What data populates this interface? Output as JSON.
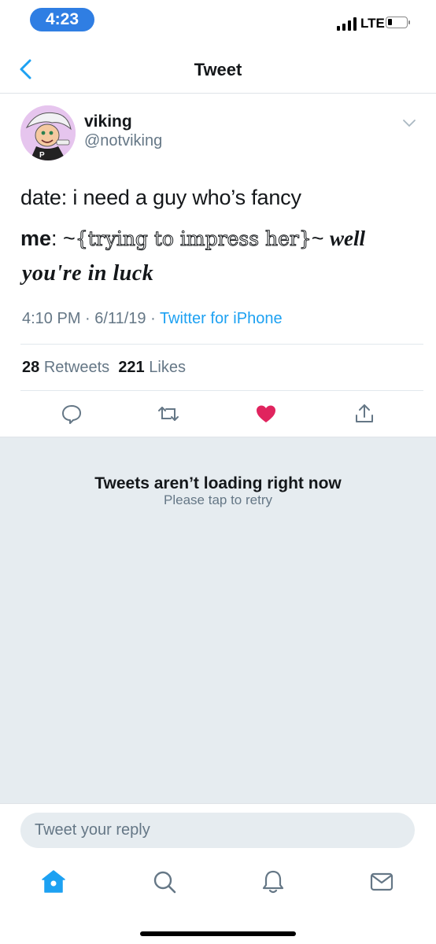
{
  "status_bar": {
    "time": "4:23",
    "network": "LTE"
  },
  "nav": {
    "title": "Tweet"
  },
  "tweet": {
    "display_name": "viking",
    "handle": "@notviking",
    "line1": "date: i need a guy who’s fancy",
    "line2_me": "me",
    "line2_colon": ": ~",
    "line2_fancy": "{trying to impress her}",
    "line2_tilde": "~ ",
    "line2_bold": "well",
    "line3": "you're in luck",
    "time": "4:10 PM",
    "date": "6/11/19",
    "source": "Twitter for iPhone",
    "retweets_count": "28",
    "retweets_label": "Retweets",
    "likes_count": "221",
    "likes_label": "Likes"
  },
  "timeline": {
    "title": "Tweets aren’t loading right now",
    "subtitle": "Please tap to retry"
  },
  "reply": {
    "placeholder": "Tweet your reply"
  },
  "colors": {
    "accent": "#1da1f2",
    "like": "#e0245e",
    "time_pill": "#2f7ee3",
    "gray_bg": "#e6ecf0"
  },
  "icons": {
    "reply": "speech-bubble",
    "retweet": "retweet-arrows",
    "like": "heart-filled",
    "share": "share-upload",
    "tabs": [
      "home",
      "search",
      "notifications-bell",
      "messages-envelope"
    ]
  }
}
